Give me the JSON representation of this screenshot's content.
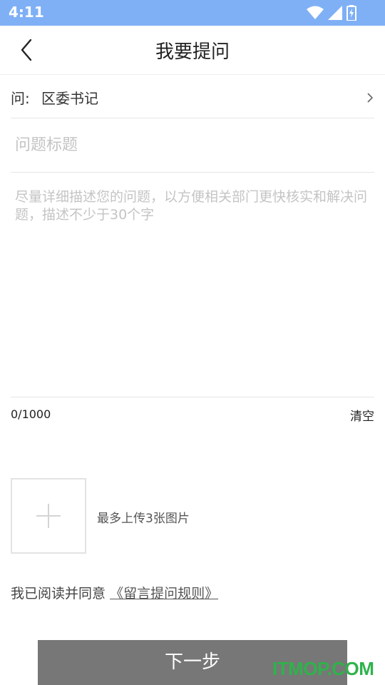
{
  "status_bar": {
    "time": "4:11",
    "icons": [
      "wifi-icon",
      "signal-icon",
      "battery-charging-icon"
    ]
  },
  "header": {
    "back_icon": "back-arrow-icon",
    "title": "我要提问"
  },
  "recipient": {
    "label": "问:",
    "value": "区委书记",
    "chevron_icon": "chevron-right-icon"
  },
  "question_title": {
    "placeholder": "问题标题",
    "value": ""
  },
  "question_content": {
    "placeholder": "尽量详细描述您的问题，以方便相关部门更快核实和解决问题，描述不少于30个字",
    "value": ""
  },
  "counter": {
    "text": "0/1000",
    "clear_label": "清空"
  },
  "upload": {
    "plus_icon": "plus-icon",
    "hint": "最多上传3张图片"
  },
  "agreement": {
    "prefix": "我已阅读并同意",
    "link": "《留言提问规则》"
  },
  "next_button": {
    "label": "下一步"
  },
  "watermark": "ITMOP.COM",
  "colors": {
    "status_bar": "#7fb0f5",
    "button": "#777777",
    "watermark": "#2fb24b",
    "placeholder": "#c4c4c4"
  }
}
